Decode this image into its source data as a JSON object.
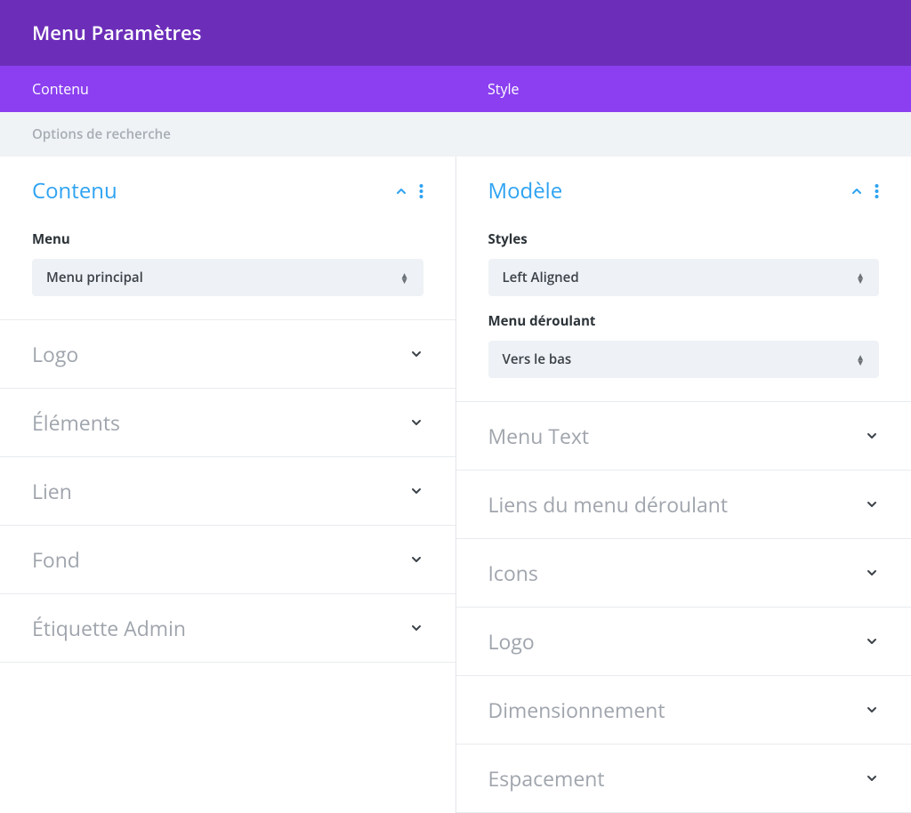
{
  "header": {
    "title": "Menu Paramètres"
  },
  "tabs": [
    {
      "label": "Contenu"
    },
    {
      "label": "Style"
    }
  ],
  "search": {
    "placeholder": "Options de recherche"
  },
  "left": {
    "expanded": {
      "title": "Contenu",
      "fields": [
        {
          "label": "Menu",
          "value": "Menu principal"
        }
      ]
    },
    "collapsed": [
      {
        "title": "Logo"
      },
      {
        "title": "Éléments"
      },
      {
        "title": "Lien"
      },
      {
        "title": "Fond"
      },
      {
        "title": "Étiquette Admin"
      }
    ]
  },
  "right": {
    "expanded": {
      "title": "Modèle",
      "fields": [
        {
          "label": "Styles",
          "value": "Left Aligned"
        },
        {
          "label": "Menu déroulant",
          "value": "Vers le bas"
        }
      ]
    },
    "collapsed": [
      {
        "title": "Menu Text"
      },
      {
        "title": "Liens du menu déroulant"
      },
      {
        "title": "Icons"
      },
      {
        "title": "Logo"
      },
      {
        "title": "Dimensionnement"
      },
      {
        "title": "Espacement"
      }
    ]
  }
}
